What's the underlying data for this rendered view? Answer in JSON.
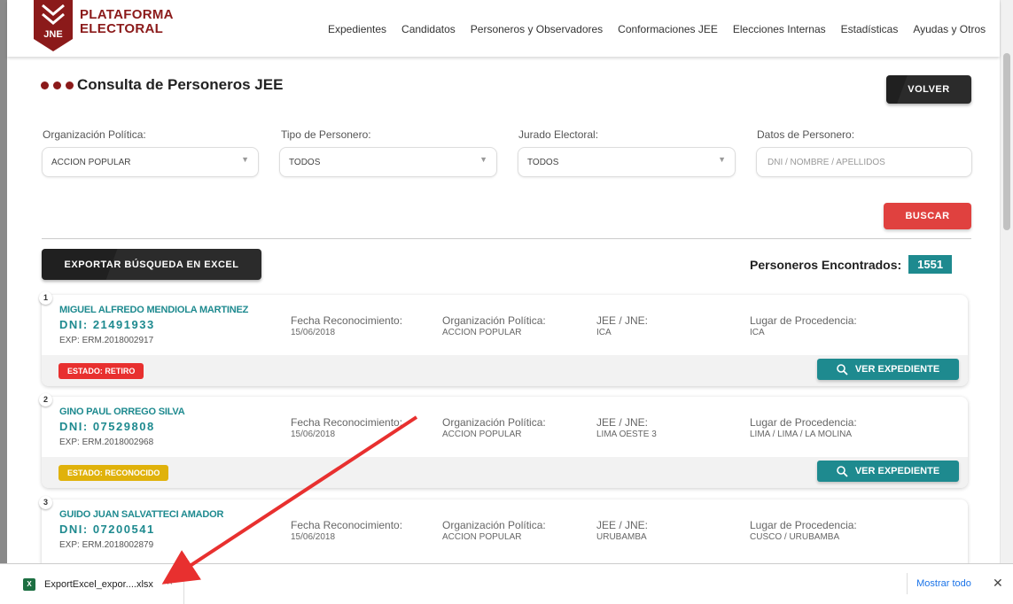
{
  "header": {
    "brand_line1": "PLATAFORMA",
    "brand_line2": "ELECTORAL",
    "logo_text": "JNE",
    "nav": [
      "Expedientes",
      "Candidatos",
      "Personeros y Observadores",
      "Conformaciones JEE",
      "Elecciones Internas",
      "Estadísticas",
      "Ayudas y Otros"
    ]
  },
  "page": {
    "title": "Consulta de Personeros JEE",
    "back_label": "VOLVER",
    "dot_colors": [
      "#8b1a1a",
      "#8b1a1a",
      "#8b1a1a"
    ]
  },
  "filters": {
    "org_label": "Organización Política:",
    "org_value": "ACCION POPULAR",
    "tipo_label": "Tipo de Personero:",
    "tipo_value": "TODOS",
    "jurado_label": "Jurado Electoral:",
    "jurado_value": "TODOS",
    "datos_label": "Datos de Personero:",
    "datos_placeholder": "DNI / NOMBRE / APELLIDOS",
    "search_label": "BUSCAR"
  },
  "results": {
    "export_label": "EXPORTAR BÚSQUEDA EN EXCEL",
    "found_label": "Personeros Encontrados:",
    "found_count": "1551",
    "fecha_label": "Fecha Reconocimiento:",
    "org_label": "Organización Política:",
    "jee_label": "JEE / JNE:",
    "lugar_label": "Lugar de Procedencia:",
    "view_label": "VER EXPEDIENTE",
    "items": [
      {
        "num": "1",
        "name": "MIGUEL ALFREDO MENDIOLA MARTINEZ",
        "dni": "DNI: 21491933",
        "exp": "EXP: ERM.2018002917",
        "fecha": "15/06/2018",
        "org": "ACCION POPULAR",
        "jee": "ICA",
        "lugar": "ICA",
        "estado": "ESTADO: RETIRO",
        "estado_color": "#e8302f"
      },
      {
        "num": "2",
        "name": "GINO PAUL ORREGO SILVA",
        "dni": "DNI: 07529808",
        "exp": "EXP: ERM.2018002968",
        "fecha": "15/06/2018",
        "org": "ACCION POPULAR",
        "jee": "LIMA OESTE 3",
        "lugar": "LIMA / LIMA / LA MOLINA",
        "estado": "ESTADO: RECONOCIDO",
        "estado_color": "#e0b20b"
      },
      {
        "num": "3",
        "name": "GUIDO JUAN SALVATTECI AMADOR",
        "dni": "DNI: 07200541",
        "exp": "EXP: ERM.2018002879",
        "fecha": "15/06/2018",
        "org": "ACCION POPULAR",
        "jee": "URUBAMBA",
        "lugar": "CUSCO / URUBAMBA",
        "estado": "",
        "estado_color": "#e0b20b"
      }
    ]
  },
  "download": {
    "file_name": "ExportExcel_expor....xlsx",
    "show_all": "Mostrar todo",
    "close": "✕"
  },
  "colors": {
    "teal": "#1e8a8f",
    "red": "#e0413f",
    "brand": "#8b1a1a"
  }
}
